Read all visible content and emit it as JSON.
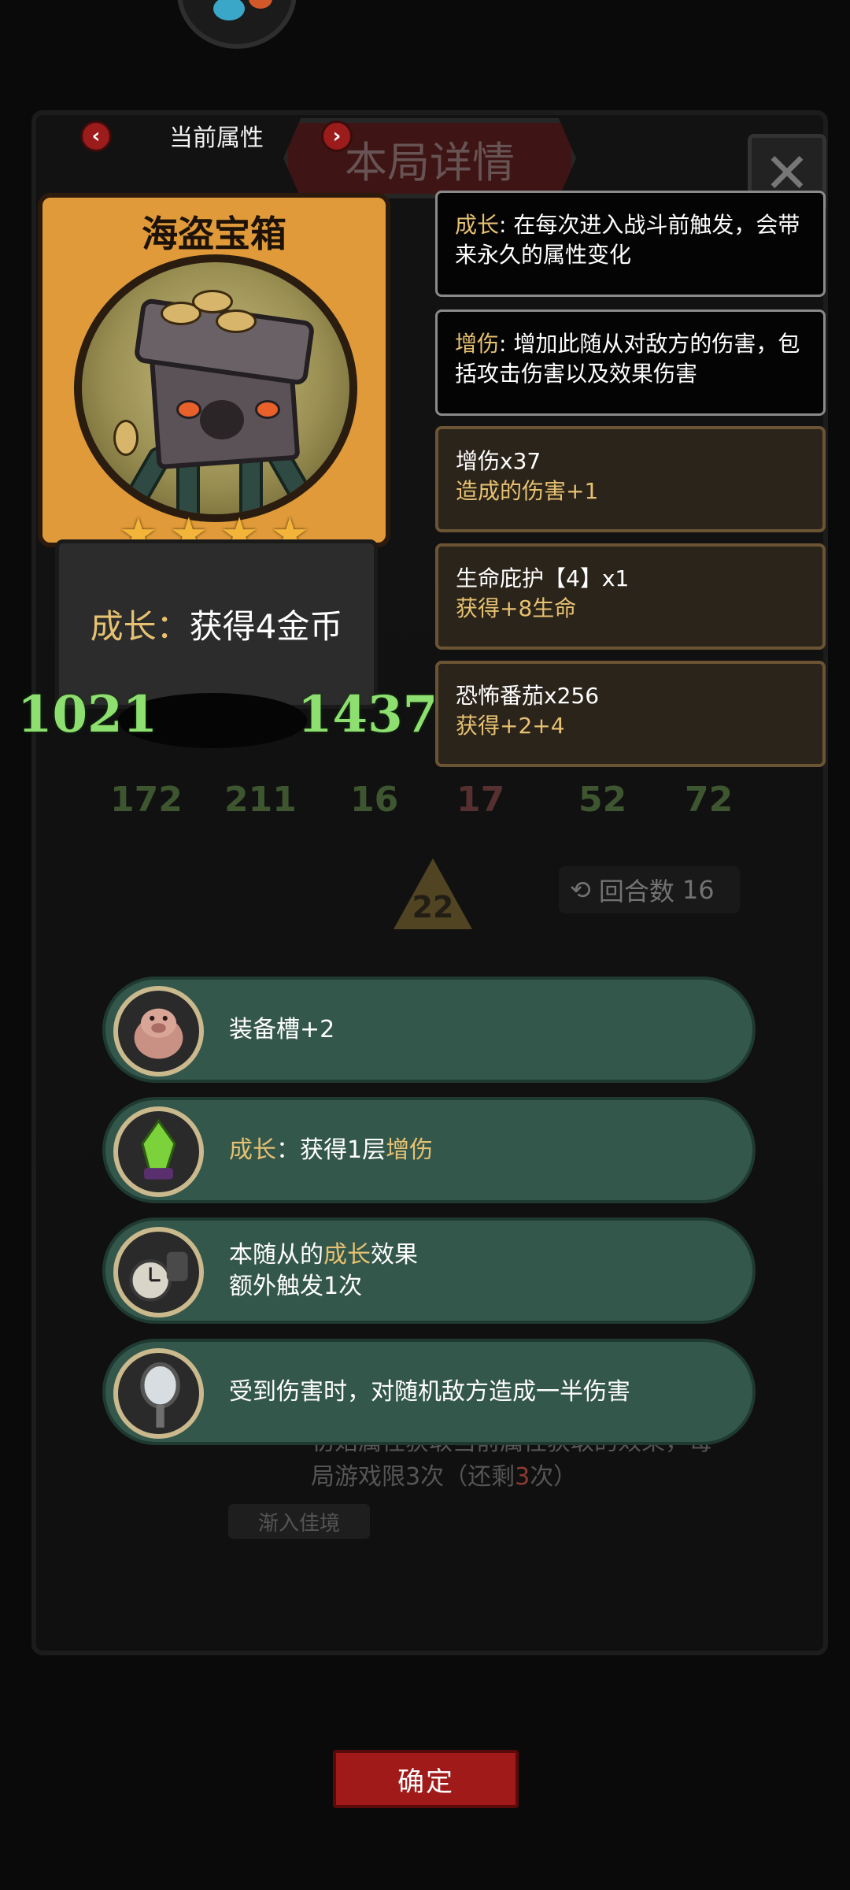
{
  "background": {
    "title": "本局详情",
    "close_glyph": "✕",
    "stats": [
      "172",
      "211",
      "16",
      "17",
      "52",
      "72"
    ],
    "level": "22",
    "rounds_label": "回合数",
    "rounds_value": "16",
    "bg_text_1": "初始属性获取当前属性获取的效果，每",
    "bg_text_2": "局游戏限3次（还剩",
    "bg_text_3": "3",
    "bg_text_4": "次）",
    "bg_tag": "渐入佳境"
  },
  "header": {
    "prev_icon": "‹",
    "title": "当前属性",
    "next_icon": "›"
  },
  "card": {
    "name": "海盗宝箱",
    "stars": 4,
    "star_glyph": "★",
    "desc_keyword": "成长",
    "desc_sep": "：",
    "desc_text": "获得4金币",
    "attack": "1021",
    "health": "1437"
  },
  "tooltips": [
    {
      "keyword": "成长",
      "text": ": 在每次进入战斗前触发，会带来永久的属性变化"
    },
    {
      "keyword": "增伤",
      "text": ": 增加此随从对敌方的伤害，包括攻击伤害以及效果伤害"
    }
  ],
  "buffs": [
    {
      "title": "增伤x37",
      "sub": "造成的伤害+1"
    },
    {
      "title": "生命庇护【4】x1",
      "sub": "获得+8生命"
    },
    {
      "title": "恐怖番茄x256",
      "sub": "获得+2+4"
    }
  ],
  "abilities": [
    {
      "icon": "pig-icon",
      "text": "装备槽+2"
    },
    {
      "icon": "crystal-icon",
      "kw1": "成长",
      "text1": "：获得1层",
      "kw2": "增伤"
    },
    {
      "icon": "pocket-watch-icon",
      "line1a": "本随从的",
      "line1kw": "成长",
      "line1b": "效果",
      "line2": "额外触发1次"
    },
    {
      "icon": "mirror-icon",
      "text": "受到伤害时，对随机敌方造成一半伤害"
    }
  ],
  "confirm_label": "确定",
  "colors": {
    "accent_gold": "#e6c171",
    "stat_green": "#8de06f",
    "pill_green": "#34574c",
    "confirm_red": "#a11a1a"
  }
}
